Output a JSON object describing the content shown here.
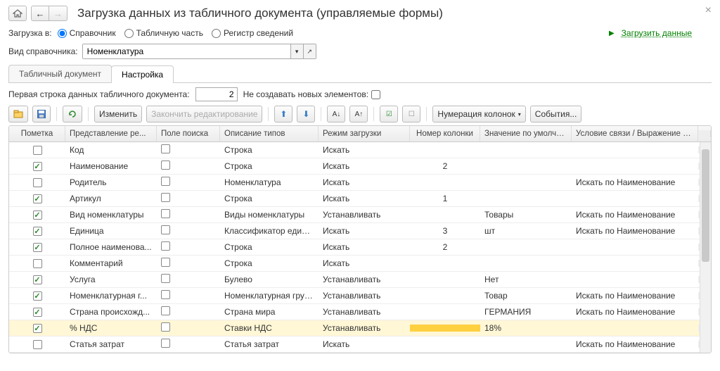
{
  "title": "Загрузка данных из табличного документа (управляемые формы)",
  "loadTo": {
    "label": "Загрузка в:",
    "options": [
      "Справочник",
      "Табличную часть",
      "Регистр сведений"
    ],
    "selected": 0
  },
  "loadLink": "Загрузить данные",
  "refKind": {
    "label": "Вид справочника:",
    "value": "Номенклатура"
  },
  "tabs": {
    "items": [
      "Табличный документ",
      "Настройка"
    ],
    "active": 1
  },
  "settings": {
    "firstRowLabel": "Первая строка данных табличного документа:",
    "firstRowValue": "2",
    "noCreateLabel": "Не создавать новых элементов:",
    "noCreateChecked": false,
    "editBtn": "Изменить",
    "finishBtn": "Закончить редактирование",
    "numColsBtn": "Нумерация колонок",
    "eventsBtn": "События..."
  },
  "columns": {
    "mark": "Пометка",
    "rep": "Представление ре...",
    "search": "Поле поиска",
    "desc": "Описание типов",
    "mode": "Режим загрузки",
    "num": "Номер колонки",
    "def": "Значение по умолча...",
    "cond": "Условие связи / Выражение д..."
  },
  "rows": [
    {
      "mark": false,
      "rep": "Код",
      "search": false,
      "desc": "Строка",
      "mode": "Искать",
      "num": "",
      "def": "",
      "cond": "",
      "sel": false
    },
    {
      "mark": true,
      "rep": "Наименование",
      "search": false,
      "desc": "Строка",
      "mode": "Искать",
      "num": "2",
      "def": "",
      "cond": "",
      "sel": false
    },
    {
      "mark": false,
      "rep": "Родитель",
      "search": false,
      "desc": "Номенклатура",
      "mode": "Искать",
      "num": "",
      "def": "",
      "cond": "Искать по Наименование",
      "sel": false
    },
    {
      "mark": true,
      "rep": "Артикул",
      "search": false,
      "desc": "Строка",
      "mode": "Искать",
      "num": "1",
      "def": "",
      "cond": "",
      "sel": false
    },
    {
      "mark": true,
      "rep": "Вид номенклатуры",
      "search": false,
      "desc": "Виды номенклатуры",
      "mode": "Устанавливать",
      "num": "",
      "def": "Товары",
      "cond": "Искать по Наименование",
      "sel": false
    },
    {
      "mark": true,
      "rep": "Единица",
      "search": false,
      "desc": "Классификатор едини...",
      "mode": "Искать",
      "num": "3",
      "def": "шт",
      "cond": "Искать по Наименование",
      "sel": false
    },
    {
      "mark": true,
      "rep": "Полное наименова...",
      "search": false,
      "desc": "Строка",
      "mode": "Искать",
      "num": "2",
      "def": "",
      "cond": "",
      "sel": false
    },
    {
      "mark": false,
      "rep": "Комментарий",
      "search": false,
      "desc": "Строка",
      "mode": "Искать",
      "num": "",
      "def": "",
      "cond": "",
      "sel": false
    },
    {
      "mark": true,
      "rep": "Услуга",
      "search": false,
      "desc": "Булево",
      "mode": "Устанавливать",
      "num": "",
      "def": "Нет",
      "cond": "",
      "sel": false
    },
    {
      "mark": true,
      "rep": "Номенклатурная г...",
      "search": false,
      "desc": "Номенклатурная группа",
      "mode": "Устанавливать",
      "num": "",
      "def": "Товар",
      "cond": "Искать по Наименование",
      "sel": false
    },
    {
      "mark": true,
      "rep": "Страна происхожд...",
      "search": false,
      "desc": "Страна мира",
      "mode": "Устанавливать",
      "num": "",
      "def": "ГЕРМАНИЯ",
      "cond": "Искать по Наименование",
      "sel": false
    },
    {
      "mark": true,
      "rep": "% НДС",
      "search": false,
      "desc": "Ставки НДС",
      "mode": "Устанавливать",
      "num": "",
      "def": "18%",
      "cond": "",
      "sel": true
    },
    {
      "mark": false,
      "rep": "Статья затрат",
      "search": false,
      "desc": "Статья затрат",
      "mode": "Искать",
      "num": "",
      "def": "",
      "cond": "Искать по Наименование",
      "sel": false
    }
  ]
}
